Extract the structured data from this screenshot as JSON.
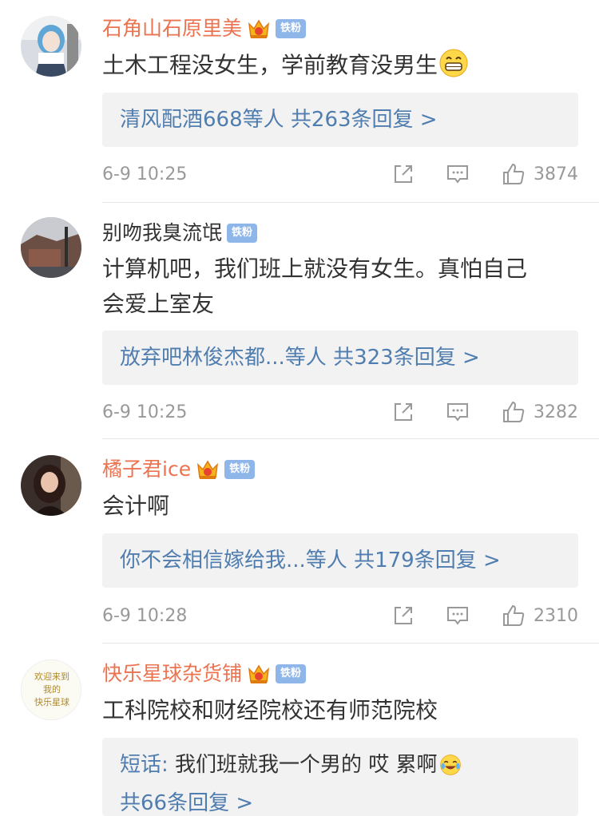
{
  "comments": [
    {
      "username": "石角山石原里美",
      "badge": "铁粉",
      "text": "土木工程没女生，学前教育没男生",
      "reply_names": "清风配酒668等人",
      "reply_count": "共263条回复 >",
      "timestamp": "6-9 10:25",
      "likes": "3874"
    },
    {
      "username": "别吻我臭流氓",
      "badge": "铁粉",
      "text_line1": "计算机吧，我们班上就没有女生。真怕自己",
      "text_line2": "会爱上室友",
      "reply_names": "放弃吧林俊杰都...等人",
      "reply_count": "共323条回复 >",
      "timestamp": "6-9 10:25",
      "likes": "3282"
    },
    {
      "username": "橘子君ice",
      "badge": "铁粉",
      "text": "会计啊",
      "reply_names": "你不会相信嫁给我...等人",
      "reply_count": "共179条回复 >",
      "timestamp": "6-9 10:28",
      "likes": "2310"
    },
    {
      "username": "快乐星球杂货铺",
      "badge": "铁粉",
      "text": "工科院校和财经院校还有师范院校",
      "reply_author": "短话:",
      "reply_text": "我们班就我一个男的  哎  累啊",
      "reply_count": "共66条回复 >",
      "avatar_text_line1": "欢迎来到",
      "avatar_text_line2": "我的",
      "avatar_text_line3": "快乐星球"
    }
  ],
  "colors": {
    "vip_name": "#eb7350",
    "link_blue": "#507daf",
    "badge_blue": "#8fb6e8",
    "meta_gray": "#999999",
    "reply_bg": "#f2f2f2"
  }
}
